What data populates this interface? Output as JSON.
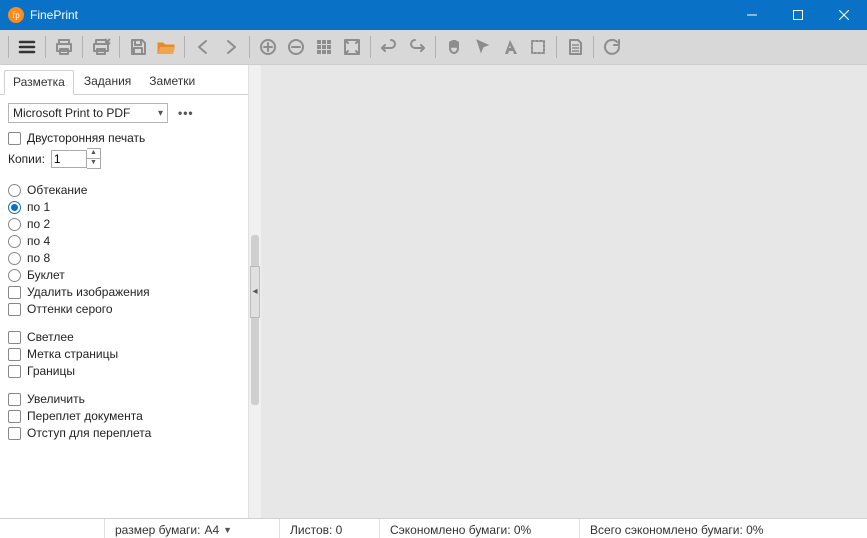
{
  "app": {
    "title": "FinePrint"
  },
  "tabs": {
    "layout": "Разметка",
    "jobs": "Задания",
    "notes": "Заметки"
  },
  "panel": {
    "printer": "Microsoft Print to PDF",
    "more": "•••",
    "duplex": "Двусторонняя печать",
    "copies_label": "Копии:",
    "copies_value": "1",
    "wrap": "Обтекание",
    "per1": "по 1",
    "per2": "по 2",
    "per4": "по 4",
    "per8": "по 8",
    "booklet": "Буклет",
    "remove_images": "Удалить изображения",
    "grayscale": "Оттенки серого",
    "lighter": "Светлее",
    "page_mark": "Метка страницы",
    "borders": "Границы",
    "enlarge": "Увеличить",
    "gutter_bind": "Переплет документа",
    "gutter_margin": "Отступ для переплета"
  },
  "status": {
    "paper_label": "размер бумаги:",
    "paper_value": "A4",
    "sheets": "Листов: 0",
    "saved": "Сэкономлено бумаги: 0%",
    "saved_total": "Всего сэкономлено бумаги: 0%"
  }
}
